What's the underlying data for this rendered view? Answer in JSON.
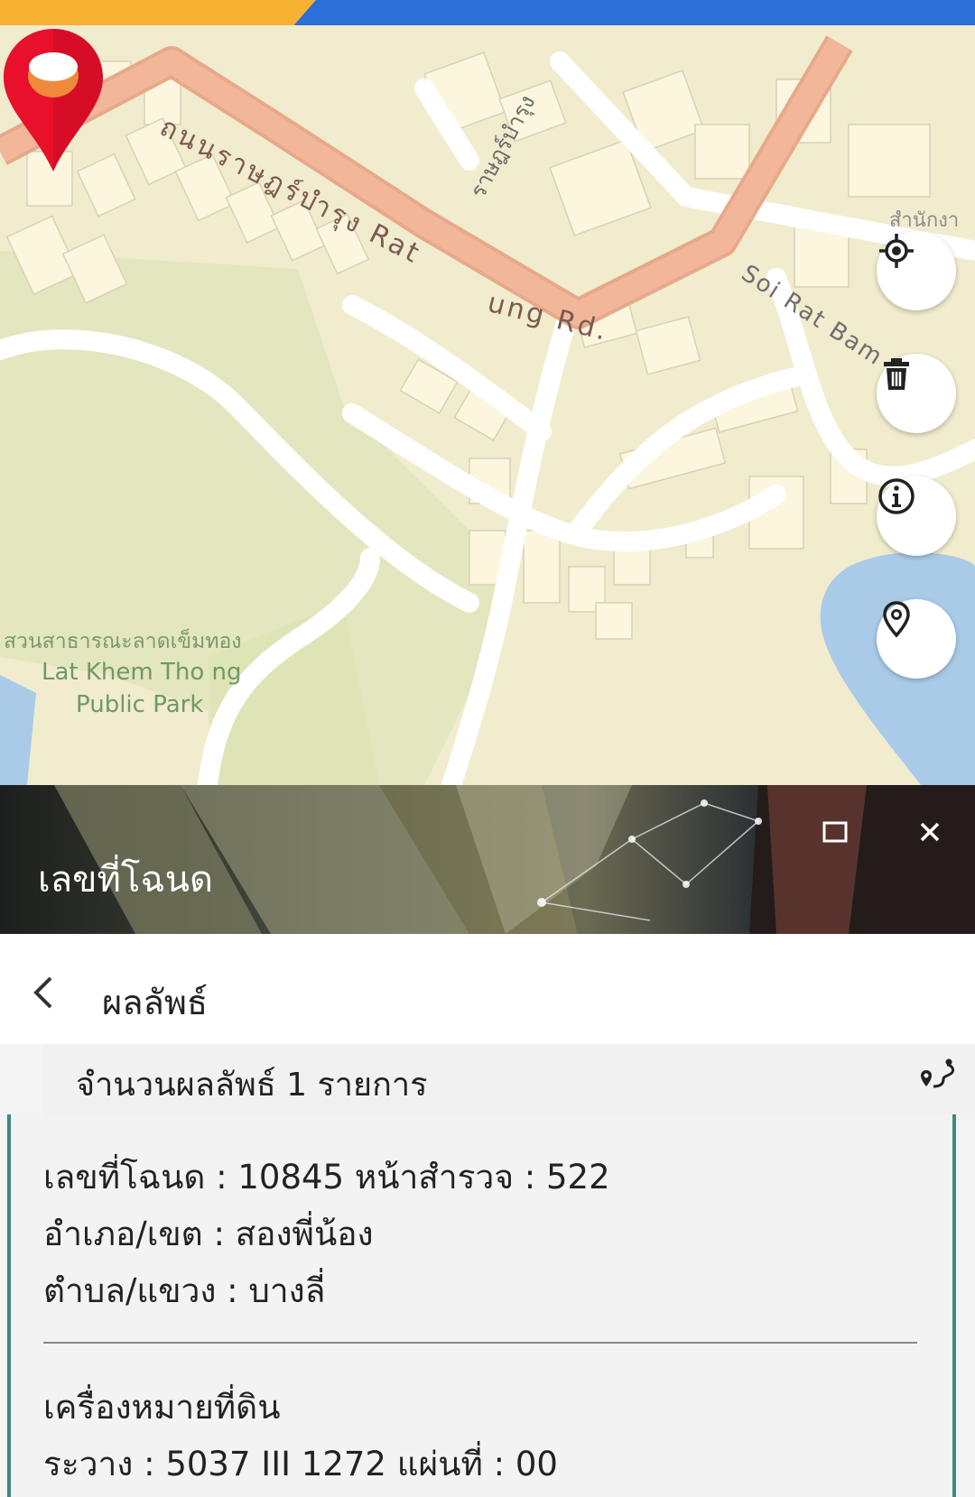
{
  "map": {
    "labels": {
      "main_road_th": "ถนนราษฎร์บำรุง Rat",
      "main_road_en": "ung Rd.",
      "side_road": "ราษฎร์บำรุง",
      "soi": "Soi Rat Bam",
      "office": "สำนักงา",
      "park_th": "สวนสาธารณะลาดเข็มทอง",
      "park_en_line1": "Lat Khem Tho ng",
      "park_en_line2": "Public Park"
    },
    "controls": {
      "locate_icon": "crosshair-icon",
      "delete_icon": "trash-icon",
      "info_icon": "info-icon",
      "pin_icon": "map-pin-icon"
    }
  },
  "panel": {
    "title": "เลขที่โฉนด",
    "maximize_icon": "maximize-icon",
    "close_icon": "close-icon"
  },
  "results": {
    "title": "ผลลัพธ์",
    "count_text": "จำนวนผลลัพธ์ 1 รายการ",
    "route_icon": "route-pin-icon",
    "item": {
      "line1": "เลขที่โฉนด : 10845 หน้าสำรวจ : 522",
      "line2": "อำเภอ/เขต : สองพี่น้อง",
      "line3": "ตำบล/แขวง : บางลี่",
      "section_title": "เครื่องหมายที่ดิน",
      "line4": "ระวาง : 5037 III 1272 แผ่นที่ : 00"
    }
  },
  "colors": {
    "top_blue": "#2c6fd6",
    "top_orange": "#f7b133",
    "pin_red": "#e8102a",
    "card_border": "#3a8a87"
  }
}
